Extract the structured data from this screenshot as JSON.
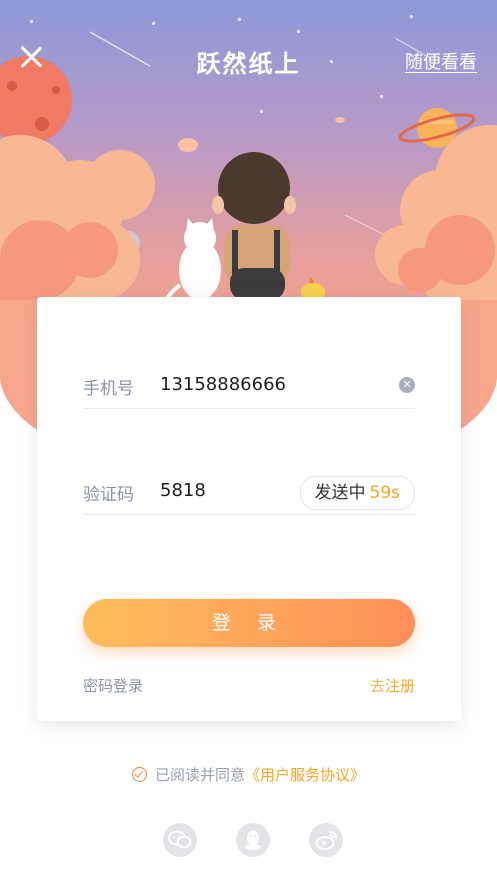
{
  "header": {
    "app_title": "跃然纸上",
    "browse_link": "随便看看",
    "close_icon": "close-icon"
  },
  "login_form": {
    "phone": {
      "label": "手机号",
      "value": "13158886666",
      "clear_icon": "clear-icon"
    },
    "code": {
      "label": "验证码",
      "value": "5818",
      "send_status": "发送中",
      "countdown": "59s"
    },
    "login_button": "登 录",
    "password_login_link": "密码登录",
    "register_prefix": "去",
    "register_link": "注册"
  },
  "agreement": {
    "text": "已阅读并同意",
    "link": "《用户服务协议》",
    "checked": true
  },
  "social_login": [
    "wechat-icon",
    "qq-icon",
    "weibo-icon"
  ],
  "colors": {
    "accent": "#f5a623",
    "button_gradient_start": "#ffbe5a",
    "button_gradient_end": "#ff8f58",
    "label_gray": "#8b93a8"
  }
}
